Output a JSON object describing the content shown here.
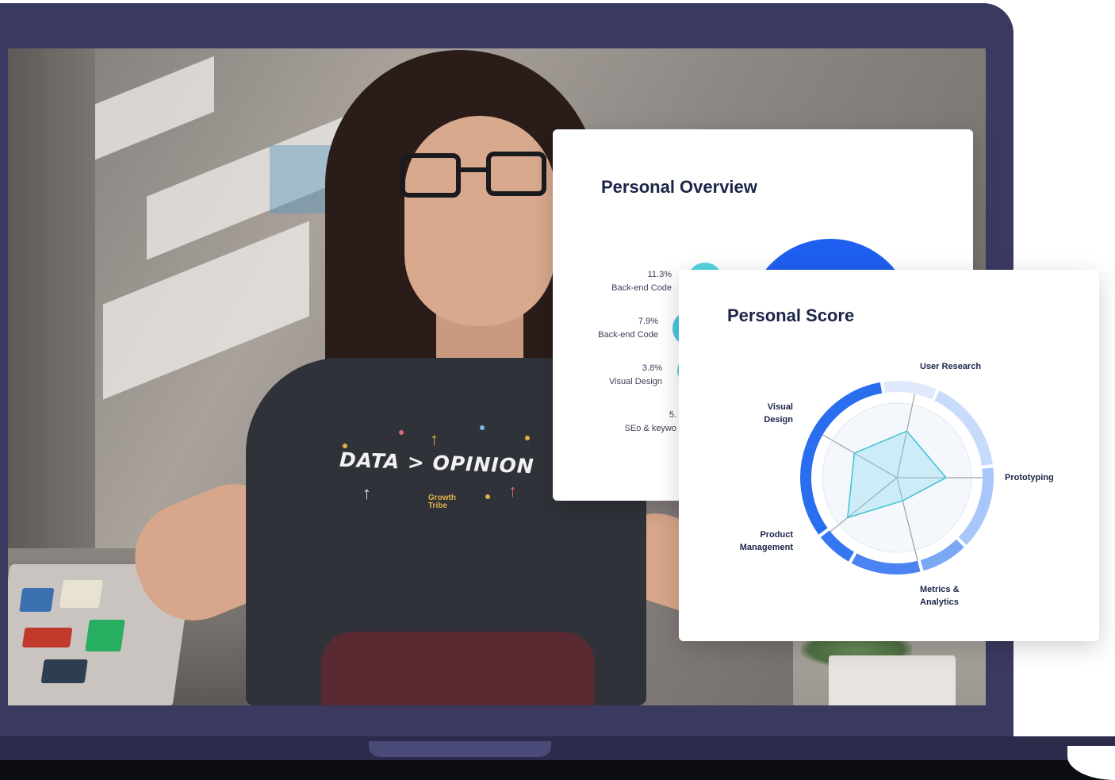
{
  "video": {
    "shirt_text": "DATA > OPINION",
    "shirt_logo_text": "Growth\nTribe"
  },
  "overview": {
    "title": "Personal Overview",
    "items": [
      {
        "pct": "11.3%",
        "label": "Back-end Code"
      },
      {
        "pct": "7.9%",
        "label": "Back-end Code"
      },
      {
        "pct": "3.8%",
        "label": "Visual Design"
      },
      {
        "pct": "5.",
        "label": "SEo & keywo"
      }
    ]
  },
  "score": {
    "title": "Personal Score",
    "axes": [
      {
        "label": "User Research"
      },
      {
        "label": "Prototyping"
      },
      {
        "label": "Metrics &\nAnalytics"
      },
      {
        "label": "Product\nManagement"
      },
      {
        "label": "Visual\nDesign"
      }
    ]
  },
  "colors": {
    "laptop": "#3a3960",
    "card_title": "#1c2448",
    "accent_blue": "#2a6ef0",
    "accent_teal": "#45c7d8"
  }
}
